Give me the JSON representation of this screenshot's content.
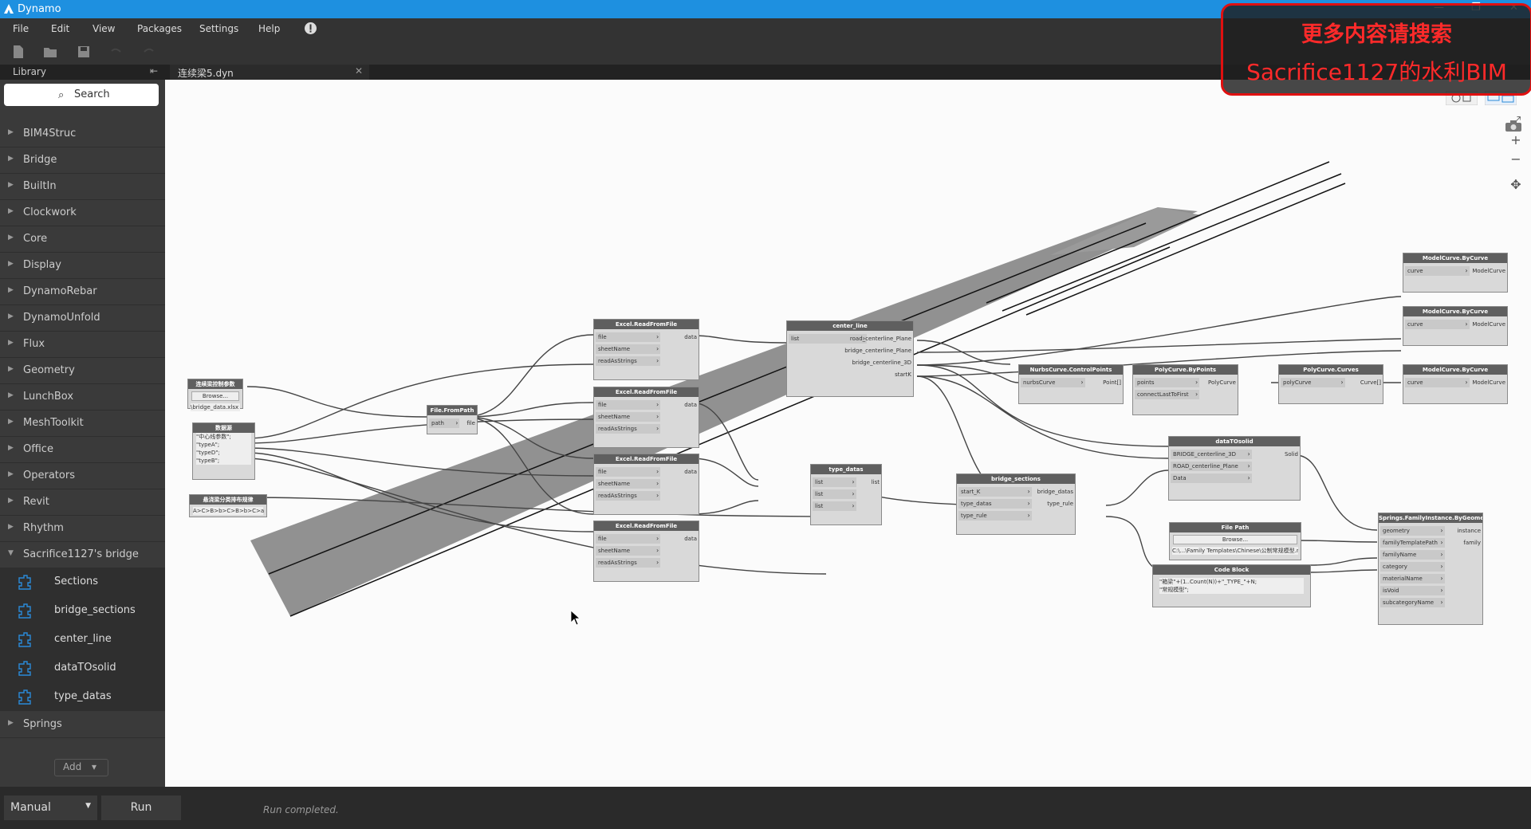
{
  "window": {
    "title": "Dynamo"
  },
  "menu": [
    "File",
    "Edit",
    "View",
    "Packages",
    "Settings",
    "Help"
  ],
  "library": {
    "header": "Library",
    "search_placeholder": "Search",
    "categories": [
      "BIM4Struc",
      "Bridge",
      "BuiltIn",
      "Clockwork",
      "Core",
      "Display",
      "DynamoRebar",
      "DynamoUnfold",
      "Flux",
      "Geometry",
      "LunchBox",
      "MeshToolkit",
      "Office",
      "Operators",
      "Revit",
      "Rhythm"
    ],
    "expanded_category": "Sacrifice1127's bridge",
    "expanded_items": [
      "Sections",
      "bridge_sections",
      "center_line",
      "dataTOsolid",
      "type_datas"
    ],
    "last_category": "Springs",
    "add_label": "Add"
  },
  "tab": {
    "file_name": "连续梁5.dyn"
  },
  "watermark": {
    "line1": "更多内容请搜索",
    "line2": "Sacrifice1127的水利BIM"
  },
  "nodes": {
    "n1": {
      "title": "连续梁控制参数",
      "browse": "Browse...",
      "path": "\\bridge_data.xlsx"
    },
    "n2": {
      "title": "数据源",
      "lines": [
        "\"中心线参数\";",
        "\"typeA\";",
        "\"typeD\";",
        "\"typeB\";"
      ]
    },
    "n3": {
      "title": "悬浇梁分类排布规律",
      "value": "A>C>B>b>C>B>b>C>a"
    },
    "ffp": {
      "title": "File.FromPath",
      "in": [
        "path"
      ],
      "out": [
        "file"
      ]
    },
    "erf": {
      "title": "Excel.ReadFromFile",
      "in": [
        "file",
        "sheetName",
        "readAsStrings"
      ],
      "out": [
        "data"
      ]
    },
    "cl": {
      "title": "center_line",
      "in": [
        "list"
      ],
      "out": [
        "road_centerline_Plane",
        "bridge_centerline_Plane",
        "bridge_centerline_3D",
        "startK"
      ]
    },
    "td": {
      "title": "type_datas",
      "in": [
        "list",
        "list",
        "list"
      ],
      "out": [
        "list"
      ]
    },
    "bs": {
      "title": "bridge_sections",
      "in": [
        "start_K",
        "type_datas",
        "type_rule"
      ],
      "out": [
        "bridge_datas",
        "type_rule"
      ]
    },
    "nc": {
      "title": "NurbsCurve.ControlPoints",
      "in": [
        "nurbsCurve"
      ],
      "out": [
        "Point[]"
      ]
    },
    "pbp": {
      "title": "PolyCurve.ByPoints",
      "in": [
        "points",
        "connectLastToFirst"
      ],
      "out": [
        "PolyCurve"
      ]
    },
    "pcc": {
      "title": "PolyCurve.Curves",
      "in": [
        "polyCurve"
      ],
      "out": [
        "Curve[]"
      ]
    },
    "mc": {
      "title": "ModelCurve.ByCurve",
      "in": [
        "curve"
      ],
      "out": [
        "ModelCurve"
      ]
    },
    "dts": {
      "title": "dataTOsolid",
      "in": [
        "BRIDGE_centerline_3D",
        "ROAD_centerline_Plane",
        "Data"
      ],
      "out": [
        "Solid"
      ]
    },
    "fp": {
      "title": "File Path",
      "browse": "Browse...",
      "path": "C:\\...\\Family Templates\\Chinese\\公制常规模型.rft"
    },
    "cb": {
      "title": "Code Block",
      "code": "\"箱梁\"+(1..Count(N))+\"_TYPE_\"+N;",
      "code2": "\"常规模型\";"
    },
    "sfi": {
      "title": "Springs.FamilyInstance.ByGeometry",
      "in": [
        "geometry",
        "familyTemplatePath",
        "familyName",
        "category",
        "materialName",
        "isVoid",
        "subcategoryName"
      ],
      "out": [
        "instance",
        "family"
      ]
    }
  },
  "run": {
    "mode": "Manual",
    "button": "Run",
    "status": "Run completed."
  }
}
